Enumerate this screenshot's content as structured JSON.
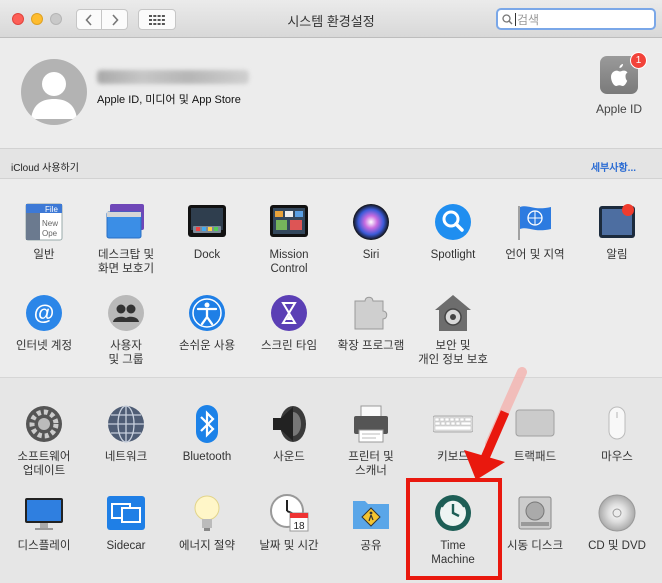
{
  "window": {
    "title": "시스템 환경설정"
  },
  "search": {
    "placeholder": "검색"
  },
  "account": {
    "subtitle": "Apple ID, 미디어 및 App Store",
    "apple_id_label": "Apple ID",
    "badge": "1"
  },
  "icloud": {
    "prompt": "iCloud 사용하기",
    "details_link": "세부사항..."
  },
  "row1": [
    {
      "label": "일반",
      "icon": "general-icon"
    },
    {
      "label": "데스크탑 및\n화면 보호기",
      "icon": "desktop-icon"
    },
    {
      "label": "Dock",
      "icon": "dock-icon"
    },
    {
      "label": "Mission\nControl",
      "icon": "mission-control-icon"
    },
    {
      "label": "Siri",
      "icon": "siri-icon"
    },
    {
      "label": "Spotlight",
      "icon": "spotlight-icon"
    },
    {
      "label": "언어 및 지역",
      "icon": "language-icon"
    },
    {
      "label": "알림",
      "icon": "notifications-icon"
    }
  ],
  "row2": [
    {
      "label": "인터넷 계정",
      "icon": "internet-accounts-icon"
    },
    {
      "label": "사용자\n및 그룹",
      "icon": "users-icon"
    },
    {
      "label": "손쉬운 사용",
      "icon": "accessibility-icon"
    },
    {
      "label": "스크린 타임",
      "icon": "screen-time-icon"
    },
    {
      "label": "확장 프로그램",
      "icon": "extensions-icon"
    },
    {
      "label": "보안 및\n개인 정보 보호",
      "icon": "security-icon"
    }
  ],
  "row3": [
    {
      "label": "소프트웨어\n업데이트",
      "icon": "software-update-icon"
    },
    {
      "label": "네트워크",
      "icon": "network-icon"
    },
    {
      "label": "Bluetooth",
      "icon": "bluetooth-icon"
    },
    {
      "label": "사운드",
      "icon": "sound-icon"
    },
    {
      "label": "프린터 및\n스캐너",
      "icon": "printer-icon"
    },
    {
      "label": "키보드",
      "icon": "keyboard-icon"
    },
    {
      "label": "트랙패드",
      "icon": "trackpad-icon"
    },
    {
      "label": "마우스",
      "icon": "mouse-icon"
    }
  ],
  "row4": [
    {
      "label": "디스플레이",
      "icon": "displays-icon"
    },
    {
      "label": "Sidecar",
      "icon": "sidecar-icon"
    },
    {
      "label": "에너지 절약",
      "icon": "energy-icon"
    },
    {
      "label": "날짜 및 시간",
      "icon": "clock-icon"
    },
    {
      "label": "공유",
      "icon": "sharing-icon"
    },
    {
      "label": "Time\nMachine",
      "icon": "time-machine-icon"
    },
    {
      "label": "시동 디스크",
      "icon": "startup-disk-icon"
    },
    {
      "label": "CD 및 DVD",
      "icon": "cd-dvd-icon"
    }
  ],
  "calendar_day": "18",
  "colors": {
    "highlight": "#e9180e",
    "link": "#2a6bd3"
  }
}
